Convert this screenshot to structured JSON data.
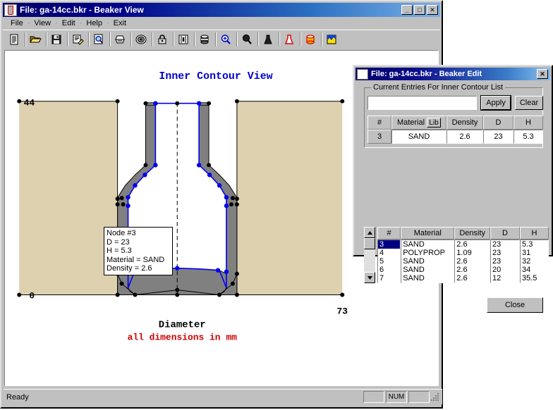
{
  "main_window": {
    "title": "File: ga-14cc.bkr - Beaker View",
    "title_icon": "beaker-icon",
    "buttons": {
      "minimize": "_",
      "maximize": "□",
      "close": "✕"
    },
    "menu": [
      "File",
      "View",
      "Edit",
      "Help",
      "Exit"
    ],
    "menu_separator": "·",
    "toolbar": [
      {
        "name": "new-document-icon",
        "tip": "New"
      },
      {
        "name": "open-folder-icon",
        "tip": "Open"
      },
      {
        "name": "save-disk-icon",
        "tip": "Save"
      },
      {
        "name": "edit-notes-icon",
        "tip": "Edit"
      },
      {
        "name": "print-preview-icon",
        "tip": "Print Preview"
      },
      {
        "name": "printer-icon",
        "tip": "Print"
      },
      {
        "name": "target-icon",
        "tip": "Target"
      },
      {
        "name": "lock-icon",
        "tip": "Lock"
      },
      {
        "name": "measure-icon",
        "tip": "Measure"
      },
      {
        "name": "cylinder-icon",
        "tip": "Cylinder"
      },
      {
        "name": "zoom-in-icon",
        "tip": "Zoom In"
      },
      {
        "name": "magnifier-icon",
        "tip": "Zoom"
      },
      {
        "name": "beaker-solid-icon",
        "tip": "Beaker"
      },
      {
        "name": "flask-outline-icon",
        "tip": "Flask"
      },
      {
        "name": "container-icon",
        "tip": "Container"
      },
      {
        "name": "graph-icon",
        "tip": "Graph"
      }
    ],
    "status": {
      "text": "Ready",
      "indicators": [
        "",
        "NUM",
        ""
      ],
      "grip": "resize-grip"
    }
  },
  "chart": {
    "title": "Inner Contour View",
    "title_color": "#0000cc",
    "x_axis_label": "Diameter",
    "note": "all dimensions in mm",
    "note_color": "#cc0000",
    "y_max_label": "44",
    "y_min_label": "0",
    "x_max_label": "73",
    "background_block_color": "#ddd1b0",
    "wall_color": "#808080",
    "inner_contour_color": "#0000ee",
    "outer_contour_color": "#000000"
  },
  "tooltip": {
    "lines": [
      "Node #3",
      "D = 23",
      "H = 5.3",
      "Material = SAND",
      "Density = 2.6"
    ]
  },
  "dialog": {
    "title": "File: ga-14cc.bkr - Beaker Edit",
    "close_button": "✕",
    "group_label": "Current Entries For Inner Contour List",
    "input_value": "",
    "apply_label": "Apply",
    "clear_label": "Clear",
    "lib_label": "Lib",
    "entry_table": {
      "headers": [
        "#",
        "Material",
        "Density",
        "D",
        "H"
      ],
      "row": [
        "3",
        "SAND",
        "2.6",
        "23",
        "5.3"
      ]
    },
    "list": {
      "headers": [
        "#",
        "Material",
        "Density",
        "D",
        "H"
      ],
      "rows": [
        {
          "num": "3",
          "material": "SAND",
          "density": "2.6",
          "d": "23",
          "h": "5.3",
          "selected": true
        },
        {
          "num": "4",
          "material": "POLYPROP",
          "density": "1.09",
          "d": "23",
          "h": "31",
          "selected": false
        },
        {
          "num": "5",
          "material": "SAND",
          "density": "2.6",
          "d": "23",
          "h": "32",
          "selected": false
        },
        {
          "num": "6",
          "material": "SAND",
          "density": "2.6",
          "d": "20",
          "h": "34",
          "selected": false
        },
        {
          "num": "7",
          "material": "SAND",
          "density": "2.6",
          "d": "12",
          "h": "35.5",
          "selected": false
        }
      ]
    },
    "scroll_up": "▲",
    "scroll_down": "▼",
    "close_label": "Close"
  }
}
